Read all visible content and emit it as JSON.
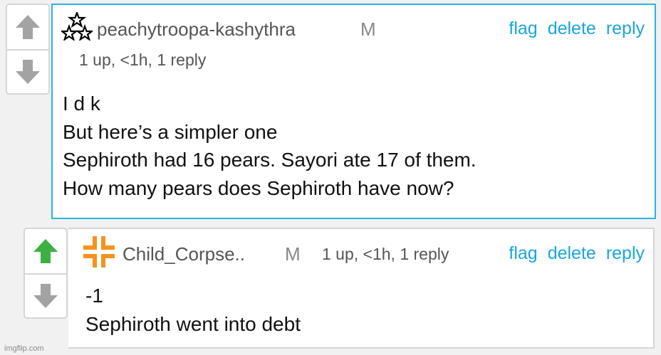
{
  "comments": [
    {
      "avatar": "three-stars-icon",
      "username": "peachytroopa-kashythra",
      "badge": "M",
      "meta": "1 up, <1h, 1 reply",
      "actions": {
        "flag": "flag",
        "delete": "delete",
        "reply": "reply"
      },
      "lines": [
        "I d k",
        "But here’s a simpler one",
        "Sephiroth had 16 pears. Sayori ate 17 of them.",
        "How many pears does Sephiroth have now?"
      ],
      "upvoted": false
    },
    {
      "avatar": "orange-cross-icon",
      "username": "Child_Corpse..",
      "badge": "M",
      "meta": "1 up, <1h, 1 reply",
      "actions": {
        "flag": "flag",
        "delete": "delete",
        "reply": "reply"
      },
      "lines": [
        "-1",
        "Sephiroth went into debt"
      ],
      "upvoted": true
    }
  ],
  "colors": {
    "link": "#1aa6db",
    "highlight_border": "#2ab4e6",
    "reply_bar": "#f7921e",
    "upvote_active": "#3cb043",
    "vote_inactive": "#a3a3a3"
  },
  "watermark": "imgflip.com"
}
